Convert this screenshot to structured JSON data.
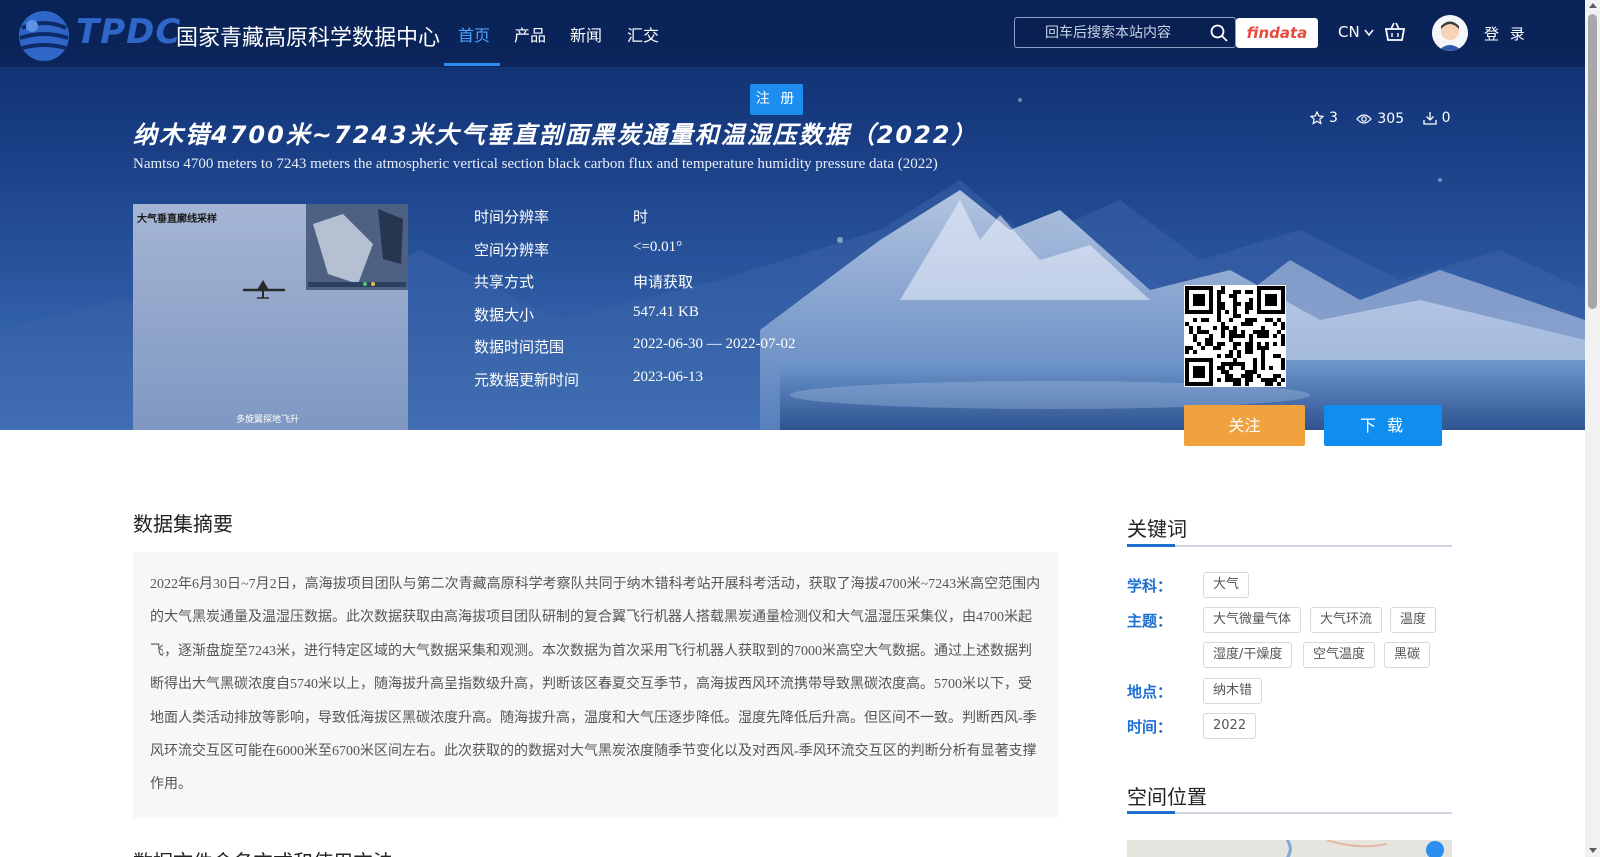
{
  "brand": {
    "logo_mark": "TPDC",
    "name_cn": "国家青藏高原科学数据中心"
  },
  "nav": {
    "items": [
      {
        "label": "首页",
        "active": true
      },
      {
        "label": "产品",
        "active": false
      },
      {
        "label": "新闻",
        "active": false
      },
      {
        "label": "汇交",
        "active": false
      }
    ],
    "search_placeholder": "回车后搜索本站内容",
    "findata_label": "findata",
    "lang_label": "CN",
    "login_label": "登 录",
    "register_label": "注 册"
  },
  "dataset": {
    "title_cn": "纳木错4700米~7243米大气垂直剖面黑炭通量和温湿压数据（2022）",
    "title_en": "Namtso 4700 meters to 7243 meters the atmospheric vertical section black carbon flux and temperature humidity pressure data (2022)",
    "stats": {
      "favorites": "3",
      "views": "305",
      "downloads": "0"
    },
    "thumbnail": {
      "caption_top": "大气垂直廓线采样",
      "caption_bottom": "多旋翼探地飞升"
    },
    "meta": [
      {
        "label": "时间分辨率",
        "value": "时"
      },
      {
        "label": "空间分辨率",
        "value": "<=0.01°"
      },
      {
        "label": "共享方式",
        "value": "申请获取"
      },
      {
        "label": "数据大小",
        "value": "547.41 KB"
      },
      {
        "label": "数据时间范围",
        "value": "2022-06-30 — 2022-07-02"
      },
      {
        "label": "元数据更新时间",
        "value": "2023-06-13"
      }
    ],
    "follow_label": "关注",
    "download_label": "下 载"
  },
  "abstract": {
    "heading": "数据集摘要",
    "text": "2022年6月30日~7月2日，高海拔项目团队与第二次青藏高原科学考察队共同于纳木错科考站开展科考活动，获取了海拔4700米~7243米高空范围内的大气黑炭通量及温湿压数据。此次数据获取由高海拔项目团队研制的复合翼飞行机器人搭载黑炭通量检测仪和大气温湿压采集仪，由4700米起飞，逐渐盘旋至7243米，进行特定区域的大气数据采集和观测。本次数据为首次采用飞行机器人获取到的7000米高空大气数据。通过上述数据判断得出大气黑碳浓度自5740米以上，随海拔升高呈指数级升高，判断该区春夏交互季节，高海拔西风环流携带导致黑碳浓度高。5700米以下，受地面人类活动排放等影响，导致低海拔区黑碳浓度升高。随海拔升高，温度和大气压逐步降低。湿度先降低后升高。但区间不一致。判断西风-季风环流交互区可能在6000米至6700米区间左右。此次获取的的数据对大气黑炭浓度随季节变化以及对西风-季风环流交互区的判断分析有显著支撑作用。",
    "next_heading": "数据文件命名方式和使用方法"
  },
  "keywords": {
    "heading": "关键词",
    "subject_label": "学科：",
    "subject_tags": [
      "大气"
    ],
    "theme_label": "主题：",
    "theme_tags": [
      "大气微量气体",
      "大气环流",
      "温度",
      "湿度/干燥度",
      "空气温度",
      "黑碳"
    ],
    "place_label": "地点：",
    "place_tags": [
      "纳木错"
    ],
    "time_label": "时间：",
    "time_tags": [
      "2022"
    ]
  },
  "spatial": {
    "heading": "空间位置"
  },
  "colors": {
    "accent": "#1e8df0",
    "follow": "#f0a23e",
    "nav_active": "#46a3ff"
  }
}
